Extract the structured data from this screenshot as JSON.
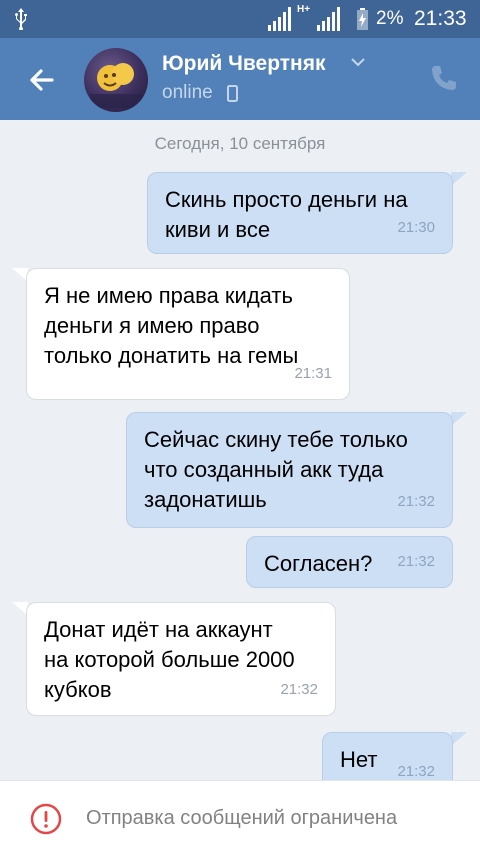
{
  "status_bar": {
    "network": "H+",
    "battery_percent": "2%",
    "time": "21:33"
  },
  "header": {
    "contact_name": "Юрий Чвертняк",
    "status": "online",
    "icons": [
      "back-arrow-icon",
      "chevron-down-icon",
      "mobile-phone-icon",
      "phone-call-icon"
    ]
  },
  "chat": {
    "date_separator": "Сегодня, 10 сентября",
    "messages": [
      {
        "direction": "outgoing",
        "lines": [
          "Скинь просто деньги на",
          "киви и все"
        ],
        "time": "21:30"
      },
      {
        "direction": "incoming",
        "lines": [
          "Я не имею права кидать",
          "деньги я имею право",
          "только донатить на гемы"
        ],
        "time": "21:31"
      },
      {
        "direction": "outgoing",
        "lines": [
          "Сейчас скину тебе только",
          "что созданный акк туда",
          "задонатишь"
        ],
        "time": "21:32"
      },
      {
        "direction": "outgoing",
        "lines": [
          "Согласен?"
        ],
        "time": "21:32"
      },
      {
        "direction": "incoming",
        "lines": [
          "Донат идёт на аккаунт",
          "на которой больше 2000",
          "кубков"
        ],
        "time": "21:32"
      },
      {
        "direction": "outgoing",
        "lines": [
          "Нет"
        ],
        "time": "21:32"
      }
    ]
  },
  "bottom_bar": {
    "restriction_text": "Отправка сообщений ограничена",
    "icon": "warning-circle-icon"
  },
  "colors": {
    "status_bar": "#3e6596",
    "header": "#5181b8",
    "chat_background": "#eceff4",
    "outgoing_bubble": "#cddff5",
    "incoming_bubble": "#ffffff",
    "warning_red": "#e64646"
  }
}
